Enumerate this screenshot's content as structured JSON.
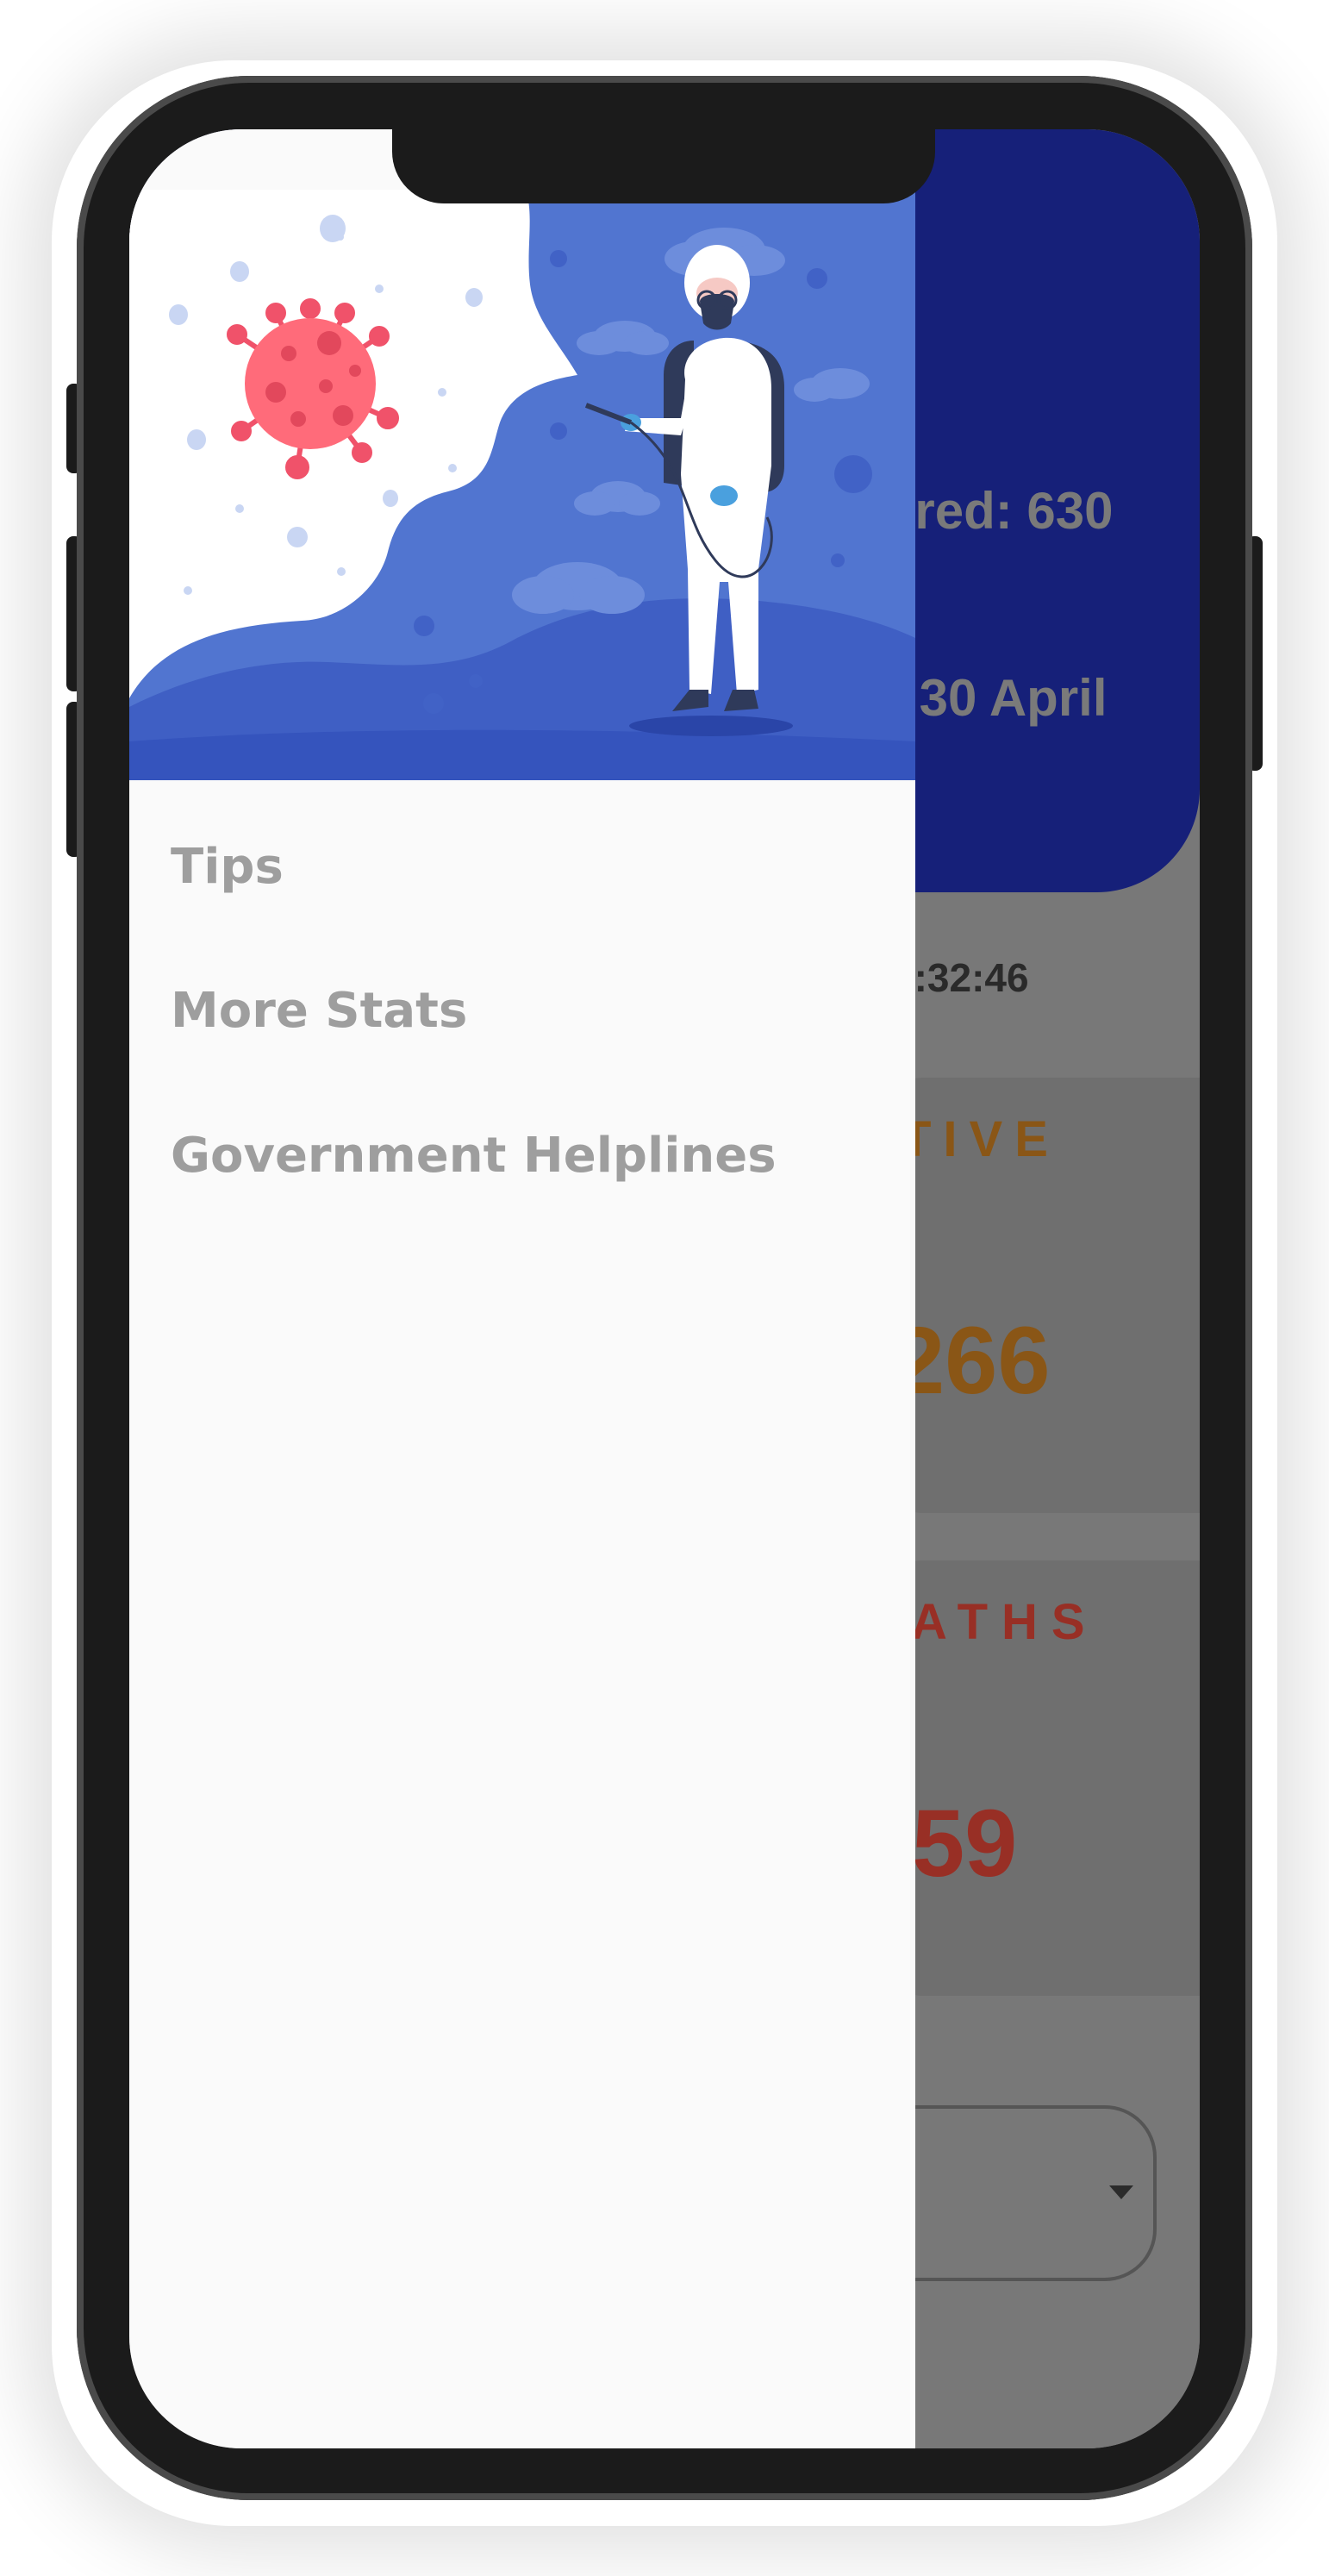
{
  "background_app": {
    "recovered_text": "ered: 630",
    "date_text": ": 30 April",
    "time_text": "1:32:46",
    "active_label": "TIVE",
    "active_value": "266",
    "deaths_label": "ATHS",
    "deaths_value": "59"
  },
  "drawer": {
    "illustration": "virus-disinfection-worker",
    "menu": [
      {
        "label": "Tips"
      },
      {
        "label": "More Stats"
      },
      {
        "label": "Government Helplines"
      }
    ]
  },
  "colors": {
    "header_blue": "#162079",
    "hero_blue": "#4f74d2",
    "active_orange": "#8a5616",
    "deaths_red": "#982f25",
    "menu_text": "#9e9e9e"
  }
}
